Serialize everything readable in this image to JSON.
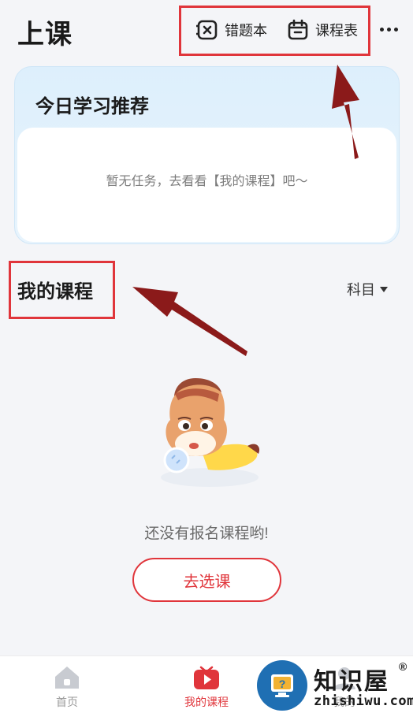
{
  "header": {
    "title": "上课",
    "wrong_book_label": "错题本",
    "schedule_label": "课程表",
    "more_icon": "more-dots-icon"
  },
  "recommend": {
    "title": "今日学习推荐",
    "empty_text": "暂无任务，去看看【我的课程】吧～"
  },
  "my_course": {
    "title": "我的课程",
    "filter_label": "科目",
    "empty_text": "还没有报名课程哟!",
    "choose_button": "去选课"
  },
  "bottom_nav": {
    "items": [
      {
        "label": "首页",
        "icon": "home-icon",
        "active": false
      },
      {
        "label": "我的课程",
        "icon": "play-icon",
        "active": true
      },
      {
        "label": "我的",
        "icon": "user-icon",
        "active": false
      }
    ]
  },
  "watermark": {
    "brand": "知识屋",
    "domain": "zhishiwu.com",
    "registered": "®"
  },
  "colors": {
    "accent": "#e0353b",
    "card_bg": "#ddeffc",
    "annotation_arrow": "#8b1a1a"
  }
}
